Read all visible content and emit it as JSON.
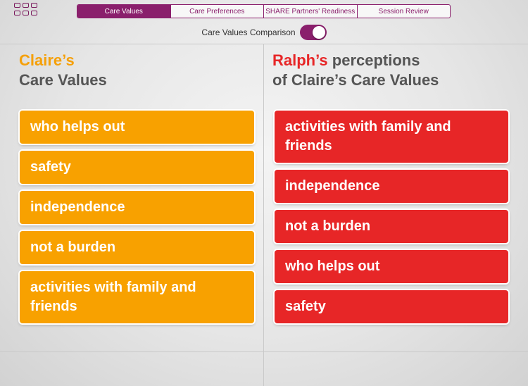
{
  "header": {
    "menu_icon": "grid-menu-icon",
    "tabs": [
      {
        "label": "Care Values",
        "active": true
      },
      {
        "label": "Care Preferences",
        "active": false
      },
      {
        "label": "SHARE Partners' Readiness",
        "active": false
      },
      {
        "label": "Session Review",
        "active": false
      }
    ],
    "toggle_label": "Care Values Comparison",
    "toggle_on": true
  },
  "left_column": {
    "name": "Claire’s",
    "title_rest": "Care Values",
    "color": "#f8a100",
    "cards": [
      "who helps out",
      "safety",
      "independence",
      "not a burden",
      "activities with family and friends"
    ]
  },
  "right_column": {
    "name": "Ralph’s",
    "title_rest_line1": "perceptions",
    "title_line2": "of Claire’s Care Values",
    "color": "#e72627",
    "cards": [
      "activities with family and friends",
      "independence",
      "not a burden",
      "who helps out",
      "safety"
    ]
  },
  "colors": {
    "accent": "#8a1f6c",
    "orange": "#f8a100",
    "red": "#e72627",
    "heading": "#555555"
  }
}
